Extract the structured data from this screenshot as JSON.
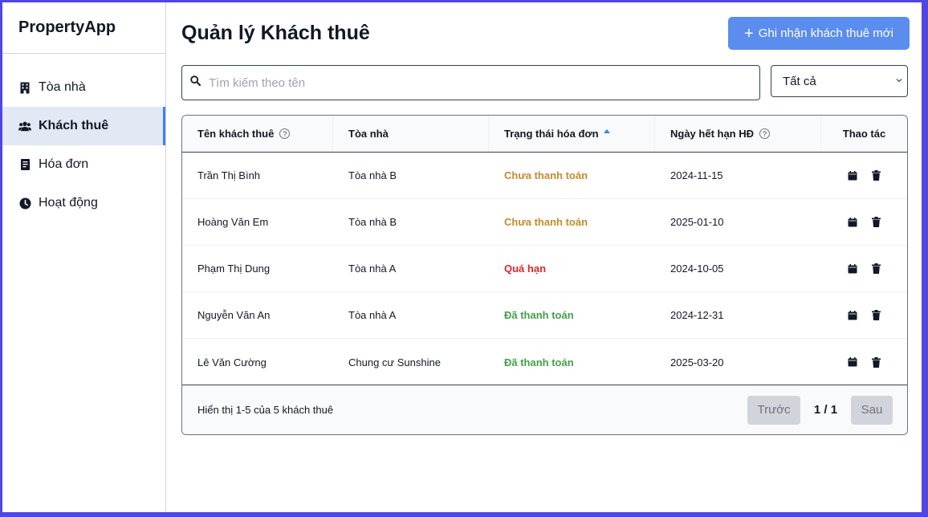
{
  "app": {
    "brand": "PropertyApp"
  },
  "sidebar": {
    "items": [
      {
        "label": "Tòa nhà",
        "icon": "building-icon",
        "active": false
      },
      {
        "label": "Khách thuê",
        "icon": "users-icon",
        "active": true
      },
      {
        "label": "Hóa đơn",
        "icon": "receipt-icon",
        "active": false
      },
      {
        "label": "Hoạt động",
        "icon": "clock-icon",
        "active": false
      }
    ]
  },
  "header": {
    "title": "Quản lý Khách thuê",
    "add_button": "Ghi nhận khách thuê mới"
  },
  "search": {
    "placeholder": "Tìm kiếm theo tên",
    "value": ""
  },
  "filter": {
    "selected": "Tất cả"
  },
  "table": {
    "columns": [
      "Tên khách thuê",
      "Tòa nhà",
      "Trạng thái hóa đơn",
      "Ngày hết hạn HĐ",
      "Thao tác"
    ],
    "rows": [
      {
        "name": "Trần Thị Bình",
        "building": "Tòa nhà B",
        "status": "Chưa thanh toán",
        "expiry": "2024-11-15"
      },
      {
        "name": "Hoàng Văn Em",
        "building": "Tòa nhà B",
        "status": "Chưa thanh toán",
        "expiry": "2025-01-10"
      },
      {
        "name": "Phạm Thị Dung",
        "building": "Tòa nhà A",
        "status": "Quá hạn",
        "expiry": "2024-10-05"
      },
      {
        "name": "Nguyễn Văn An",
        "building": "Tòa nhà A",
        "status": "Đã thanh toán",
        "expiry": "2024-12-31"
      },
      {
        "name": "Lê Văn Cường",
        "building": "Chung cư Sunshine",
        "status": "Đã thanh toán",
        "expiry": "2025-03-20"
      }
    ]
  },
  "status_colors": {
    "Chưa thanh toán": "#c68a2b",
    "Quá hạn": "#dc2626",
    "Đã thanh toán": "#43a047"
  },
  "footer": {
    "info": "Hiển thị 1-5 của 5 khách thuê",
    "prev": "Trước",
    "page": "1 / 1",
    "next": "Sau"
  },
  "colors": {
    "accent": "#5b8def",
    "frame": "#4f46e5",
    "active_bg": "#e2e8f4"
  }
}
